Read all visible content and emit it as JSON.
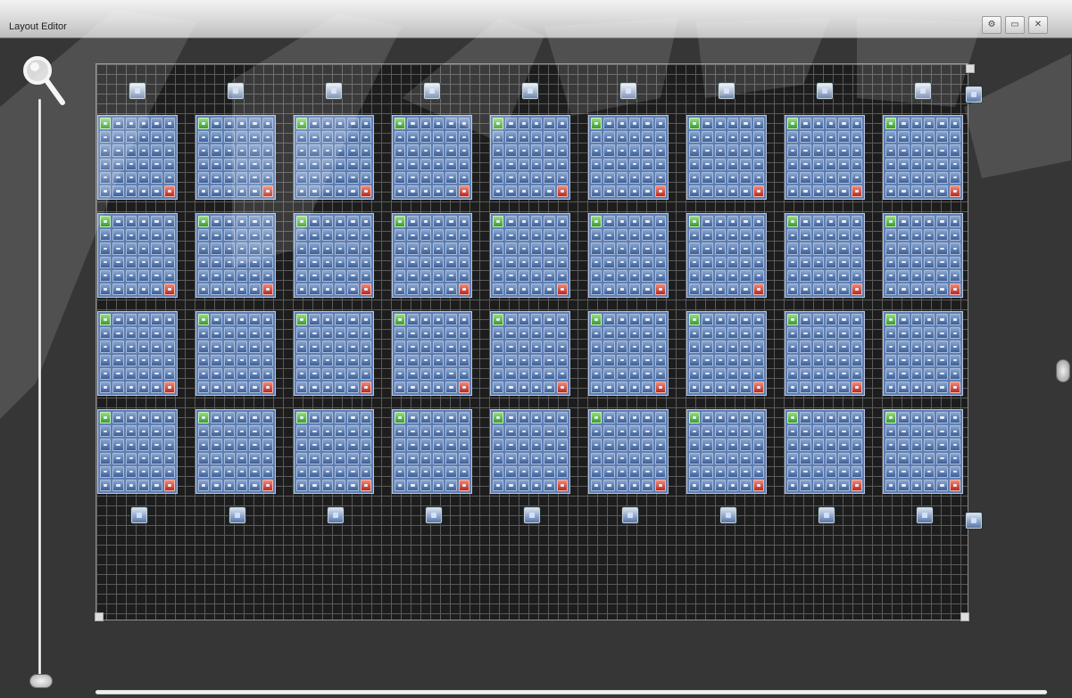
{
  "window": {
    "title": "Layout Editor",
    "title_buttons": [
      "settings-icon",
      "restore-icon",
      "close-icon"
    ]
  },
  "toolbar": {
    "zoom_icon": "magnifier-icon",
    "zoom_slider_icon": "zoom-slider-handle-icon"
  },
  "layout": {
    "panel_rows": 4,
    "panel_columns": 9,
    "cells_per_panel": 36,
    "start_cell_color": "#4caf3a",
    "end_cell_color": "#c62f24",
    "cell_color": "#4e6fa3"
  },
  "colors": {
    "background": "#363636",
    "grid_line": "#5a5a5a",
    "title_bar": "#d8d8d8"
  }
}
